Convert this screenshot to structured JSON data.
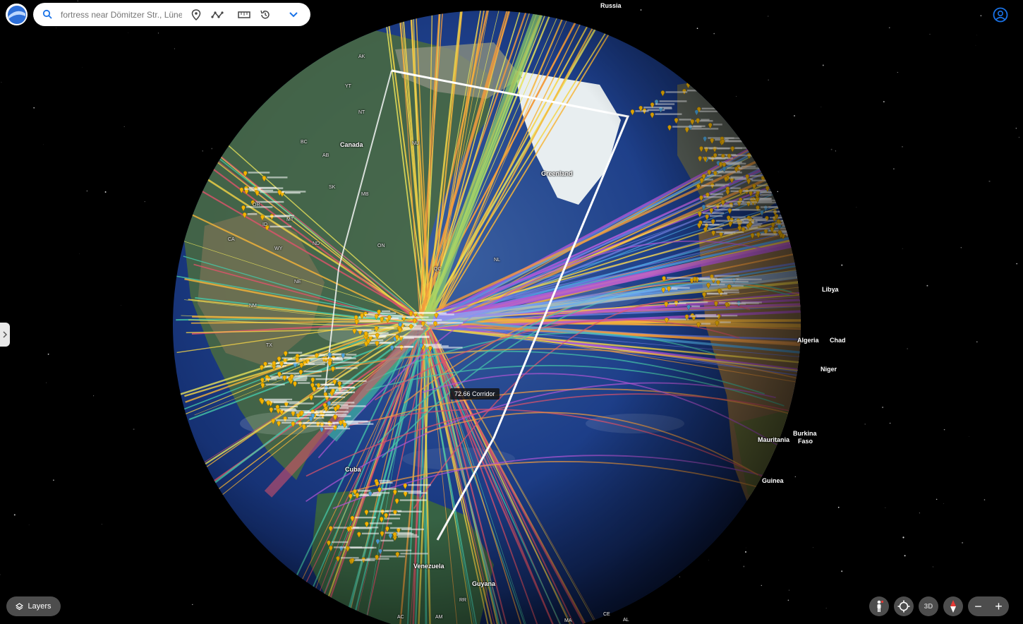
{
  "search": {
    "placeholder": "fortress near Dömitzer Str., Lüne",
    "value": ""
  },
  "toolbar": {
    "items": [
      {
        "name": "place-marker-icon"
      },
      {
        "name": "path-icon"
      },
      {
        "name": "ruler-icon"
      },
      {
        "name": "history-icon"
      },
      {
        "name": "chevron-down-icon"
      }
    ]
  },
  "layers": {
    "label": "Layers"
  },
  "controls": {
    "threed": "3D",
    "zoom_out": "−",
    "zoom_in": "+"
  },
  "tooltip": {
    "corridor": "72.66 Corridor"
  },
  "labels": {
    "russia": "Russia",
    "greenland": "Greenland",
    "canada": "Canada",
    "libya": "Libya",
    "algeria": "Algeria",
    "chad": "Chad",
    "niger": "Niger",
    "mauritania": "Mauritania",
    "burkina": "Burkina",
    "faso": "Faso",
    "guinea": "Guinea",
    "cuba": "Cuba",
    "venezuela": "Venezuela",
    "guyana": "Guyana",
    "ak": "AK",
    "yt": "YT",
    "nt": "NT",
    "nu": "NU",
    "bc": "BC",
    "ab": "AB",
    "sk": "SK",
    "mb": "MB",
    "on": "ON",
    "qc": "QC",
    "nl": "NL",
    "or": "OR",
    "id": "ID",
    "mt": "MT",
    "wy": "WY",
    "ca": "CA",
    "nd": "ND",
    "ne": "NE",
    "nm": "NM",
    "tx": "TX",
    "rr": "RR",
    "ac": "AC",
    "am": "AM",
    "ma": "MA",
    "ce": "CE",
    "al": "AL"
  },
  "colors": {
    "space": "#000000",
    "ocean": "#1a3f8f",
    "ice": "#e8eef0",
    "pin": "#f4b400",
    "accent": "#1a73e8"
  }
}
